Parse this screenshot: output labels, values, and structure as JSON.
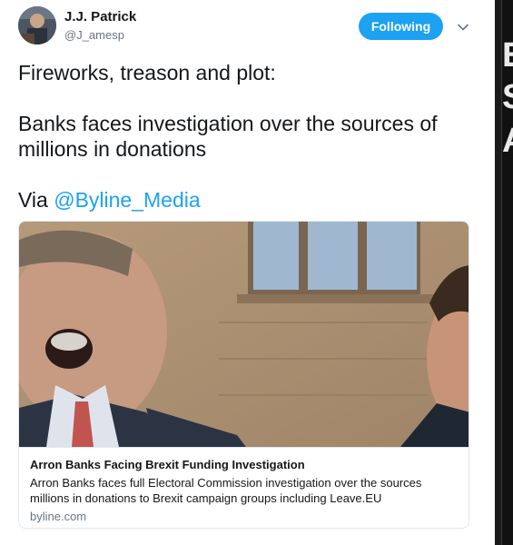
{
  "author": {
    "name": "J.J. Patrick",
    "handle": "@J_amesp"
  },
  "follow_button": {
    "label": "Following"
  },
  "icons": {
    "menu": "chevron-down-icon",
    "avatar": "user-photo"
  },
  "tweet": {
    "line1": "Fireworks, treason and plot:",
    "line2": "Banks faces investigation over the sources of millions in donations",
    "via_prefix": "Via ",
    "mention": "@Byline_Media"
  },
  "card": {
    "title": "Arron Banks Facing Brexit Funding Investigation",
    "description": "Arron Banks faces full Electoral Commission investigation over the sources millions in donations to Brexit campaign groups including Leave.EU",
    "domain": "byline.com"
  },
  "colors": {
    "accent": "#1da1f2",
    "text": "#14171a",
    "muted": "#657786",
    "border": "#e1e8ed"
  },
  "background_strip": {
    "glyphs": [
      "E",
      "S",
      "A"
    ]
  }
}
